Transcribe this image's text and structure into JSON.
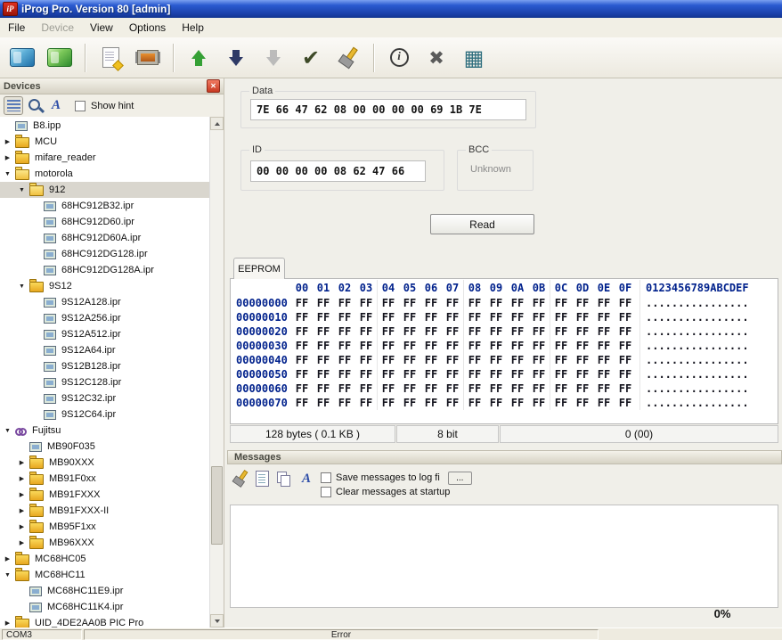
{
  "window": {
    "title": "iProg Pro. Version 80 [admin]",
    "logo_text": "iP"
  },
  "menu": {
    "items": [
      {
        "label": "File"
      },
      {
        "label": "Device",
        "disabled": true
      },
      {
        "label": "View"
      },
      {
        "label": "Options"
      },
      {
        "label": "Help"
      }
    ]
  },
  "toolbar": {
    "icons": [
      {
        "name": "open-programmer-icon",
        "cls": "ic-prog"
      },
      {
        "name": "save-programmer-icon",
        "cls": "ic-prog green"
      },
      {
        "name": "new-file-icon",
        "cls": "ic-page",
        "sep": true
      },
      {
        "name": "chip-icon",
        "cls": "ic-chip"
      },
      {
        "name": "read-device-arrow-up-icon",
        "cls": "ic-arrow up",
        "sep": true
      },
      {
        "name": "write-device-arrow-down-icon",
        "cls": "ic-arrow down"
      },
      {
        "name": "write-disabled-arrow-down-icon",
        "cls": "ic-arrow down gray",
        "disabled": true
      },
      {
        "name": "verify-check-icon",
        "cls": "ic-check",
        "glyph": "✔"
      },
      {
        "name": "erase-broom-icon",
        "cls": "ic-broom"
      },
      {
        "name": "info-icon",
        "cls": "ic-info",
        "sep": true
      },
      {
        "name": "cancel-x-icon",
        "cls": "ic-close",
        "glyph": "✖"
      },
      {
        "name": "calculator-icon",
        "cls": "ic-calc",
        "glyph": "▦"
      }
    ]
  },
  "devices_panel": {
    "title": "Devices",
    "show_hint_label": "Show hint",
    "icons": [
      {
        "name": "tree-list-view-icon",
        "cls": "ic-list",
        "pressed": true
      },
      {
        "name": "search-icon",
        "cls": "ic-mag"
      },
      {
        "name": "font-icon",
        "cls": "ic-fontA",
        "glyph": "A"
      }
    ],
    "tree": [
      {
        "label": "B8.ipp",
        "level": 1,
        "icon": "chip",
        "exp": ""
      },
      {
        "label": "MCU",
        "level": 1,
        "icon": "folder",
        "exp": "collapsed"
      },
      {
        "label": "mifare_reader",
        "level": 1,
        "icon": "folder",
        "exp": "collapsed"
      },
      {
        "label": "motorola",
        "level": 1,
        "icon": "folder-open",
        "exp": "expanded"
      },
      {
        "label": "912",
        "level": 2,
        "icon": "folder-open",
        "exp": "expanded",
        "selected": true
      },
      {
        "label": "68HC912B32.ipr",
        "level": 3,
        "icon": "chip",
        "exp": ""
      },
      {
        "label": "68HC912D60.ipr",
        "level": 3,
        "icon": "chip",
        "exp": ""
      },
      {
        "label": "68HC912D60A.ipr",
        "level": 3,
        "icon": "chip",
        "exp": ""
      },
      {
        "label": "68HC912DG128.ipr",
        "level": 3,
        "icon": "chip",
        "exp": ""
      },
      {
        "label": "68HC912DG128A.ipr",
        "level": 3,
        "icon": "chip",
        "exp": ""
      },
      {
        "label": "9S12",
        "level": 2,
        "icon": "folder",
        "exp": "expanded"
      },
      {
        "label": "9S12A128.ipr",
        "level": 3,
        "icon": "chip",
        "exp": ""
      },
      {
        "label": "9S12A256.ipr",
        "level": 3,
        "icon": "chip",
        "exp": ""
      },
      {
        "label": "9S12A512.ipr",
        "level": 3,
        "icon": "chip",
        "exp": ""
      },
      {
        "label": "9S12A64.ipr",
        "level": 3,
        "icon": "chip",
        "exp": ""
      },
      {
        "label": "9S12B128.ipr",
        "level": 3,
        "icon": "chip",
        "exp": ""
      },
      {
        "label": "9S12C128.ipr",
        "level": 3,
        "icon": "chip",
        "exp": ""
      },
      {
        "label": "9S12C32.ipr",
        "level": 3,
        "icon": "chip",
        "exp": ""
      },
      {
        "label": "9S12C64.ipr",
        "level": 3,
        "icon": "chip",
        "exp": ""
      },
      {
        "label": "Fujitsu",
        "level": 1,
        "icon": "node",
        "exp": "expanded"
      },
      {
        "label": "MB90F035",
        "level": 2,
        "icon": "chip",
        "exp": ""
      },
      {
        "label": "MB90XXX",
        "level": 2,
        "icon": "folder",
        "exp": "collapsed"
      },
      {
        "label": "MB91F0xx",
        "level": 2,
        "icon": "folder",
        "exp": "collapsed"
      },
      {
        "label": "MB91FXXX",
        "level": 2,
        "icon": "folder",
        "exp": "collapsed"
      },
      {
        "label": "MB91FXXX-II",
        "level": 2,
        "icon": "folder",
        "exp": "collapsed"
      },
      {
        "label": "MB95F1xx",
        "level": 2,
        "icon": "folder",
        "exp": "collapsed"
      },
      {
        "label": "MB96XXX",
        "level": 2,
        "icon": "folder",
        "exp": "collapsed"
      },
      {
        "label": "MC68HC05",
        "level": 1,
        "icon": "folder",
        "exp": "collapsed"
      },
      {
        "label": "MC68HC11",
        "level": 1,
        "icon": "folder",
        "exp": "expanded"
      },
      {
        "label": "MC68HC11E9.ipr",
        "level": 2,
        "icon": "chip",
        "exp": ""
      },
      {
        "label": "MC68HC11K4.ipr",
        "level": 2,
        "icon": "chip",
        "exp": ""
      },
      {
        "label": "UID_4DE2AA0B PIC Pro",
        "level": 1,
        "icon": "folder",
        "exp": "collapsed"
      }
    ]
  },
  "data_group": {
    "label": "Data",
    "value": "7E 66 47 62 08 00 00 00 00 69 1B 7E"
  },
  "id_group": {
    "label": "ID",
    "value": "00 00 00 00 08 62 47 66"
  },
  "bcc_group": {
    "label": "BCC",
    "value": "Unknown"
  },
  "read_button": "Read",
  "eeprom": {
    "tab": "EEPROM",
    "col_headers": [
      "00",
      "01",
      "02",
      "03",
      "04",
      "05",
      "06",
      "07",
      "08",
      "09",
      "0A",
      "0B",
      "0C",
      "0D",
      "0E",
      "0F"
    ],
    "ascii_header": "0123456789ABCDEF",
    "rows": [
      {
        "addr": "00000000",
        "bytes": "FF FF FF FF FF FF FF FF FF FF FF FF FF FF FF FF",
        "ascii": "................"
      },
      {
        "addr": "00000010",
        "bytes": "FF FF FF FF FF FF FF FF FF FF FF FF FF FF FF FF",
        "ascii": "................"
      },
      {
        "addr": "00000020",
        "bytes": "FF FF FF FF FF FF FF FF FF FF FF FF FF FF FF FF",
        "ascii": "................"
      },
      {
        "addr": "00000030",
        "bytes": "FF FF FF FF FF FF FF FF FF FF FF FF FF FF FF FF",
        "ascii": "................"
      },
      {
        "addr": "00000040",
        "bytes": "FF FF FF FF FF FF FF FF FF FF FF FF FF FF FF FF",
        "ascii": "................"
      },
      {
        "addr": "00000050",
        "bytes": "FF FF FF FF FF FF FF FF FF FF FF FF FF FF FF FF",
        "ascii": "................"
      },
      {
        "addr": "00000060",
        "bytes": "FF FF FF FF FF FF FF FF FF FF FF FF FF FF FF FF",
        "ascii": "................"
      },
      {
        "addr": "00000070",
        "bytes": "FF FF FF FF FF FF FF FF FF FF FF FF FF FF FF FF",
        "ascii": "................"
      }
    ],
    "status": [
      "128 bytes ( 0.1 KB )",
      "8 bit",
      "0 (00)"
    ]
  },
  "messages": {
    "title": "Messages",
    "icons": [
      {
        "name": "clear-messages-broom-icon",
        "cls": "ic-broom sm"
      },
      {
        "name": "save-messages-icon",
        "cls": "ic-doc"
      },
      {
        "name": "copy-messages-icon",
        "cls": "ic-copy"
      },
      {
        "name": "messages-font-icon",
        "cls": "ic-fontA",
        "glyph": "A"
      }
    ],
    "save_label": "Save messages to log fi",
    "browse_label": "...",
    "clear_label": "Clear messages at startup",
    "progress": "0%"
  },
  "statusbar": {
    "port": "COM3",
    "error": "Error"
  }
}
